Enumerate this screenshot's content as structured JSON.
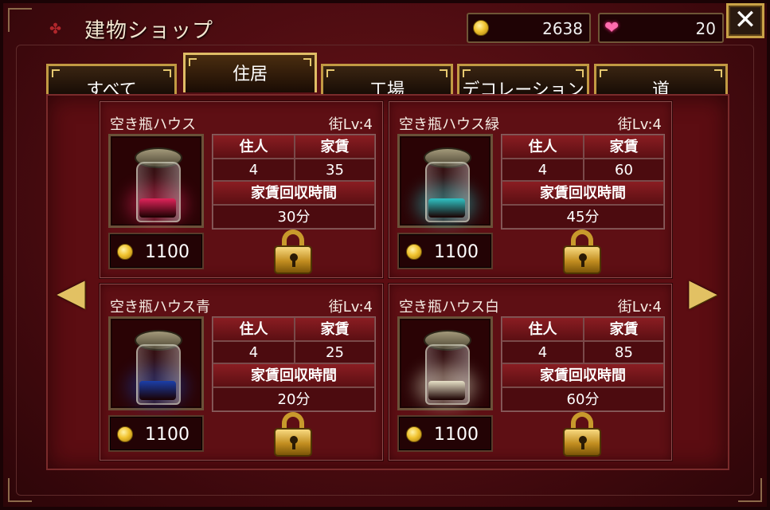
{
  "header": {
    "title": "建物ショップ",
    "gold": "2638",
    "hearts": "20",
    "close_label": "✕"
  },
  "tabs": [
    {
      "label": "すべて",
      "active": false
    },
    {
      "label": "住居",
      "active": true
    },
    {
      "label": "工場",
      "active": false
    },
    {
      "label": "デコレーション",
      "active": false
    },
    {
      "label": "道",
      "active": false
    }
  ],
  "table_labels": {
    "residents": "住人",
    "rent": "家賃",
    "rent_time": "家賃回収時間"
  },
  "cards": [
    {
      "name": "空き瓶ハウス",
      "level": "街Lv:4",
      "residents": "4",
      "rent": "35",
      "time": "30分",
      "price": "1100",
      "accent": "#e0245a"
    },
    {
      "name": "空き瓶ハウス緑",
      "level": "街Lv:4",
      "residents": "4",
      "rent": "60",
      "time": "45分",
      "price": "1100",
      "accent": "#2fc2c4"
    },
    {
      "name": "空き瓶ハウス青",
      "level": "街Lv:4",
      "residents": "4",
      "rent": "25",
      "time": "20分",
      "price": "1100",
      "accent": "#1b3fa8"
    },
    {
      "name": "空き瓶ハウス白",
      "level": "街Lv:4",
      "residents": "4",
      "rent": "85",
      "time": "60分",
      "price": "1100",
      "accent": "#e8e2c8"
    }
  ],
  "icons": {
    "nav_left": "◀",
    "nav_right": "▶",
    "heart": "❤"
  },
  "colors": {
    "frame_gold": "#c29a43",
    "panel_red": "#5c0d12"
  }
}
